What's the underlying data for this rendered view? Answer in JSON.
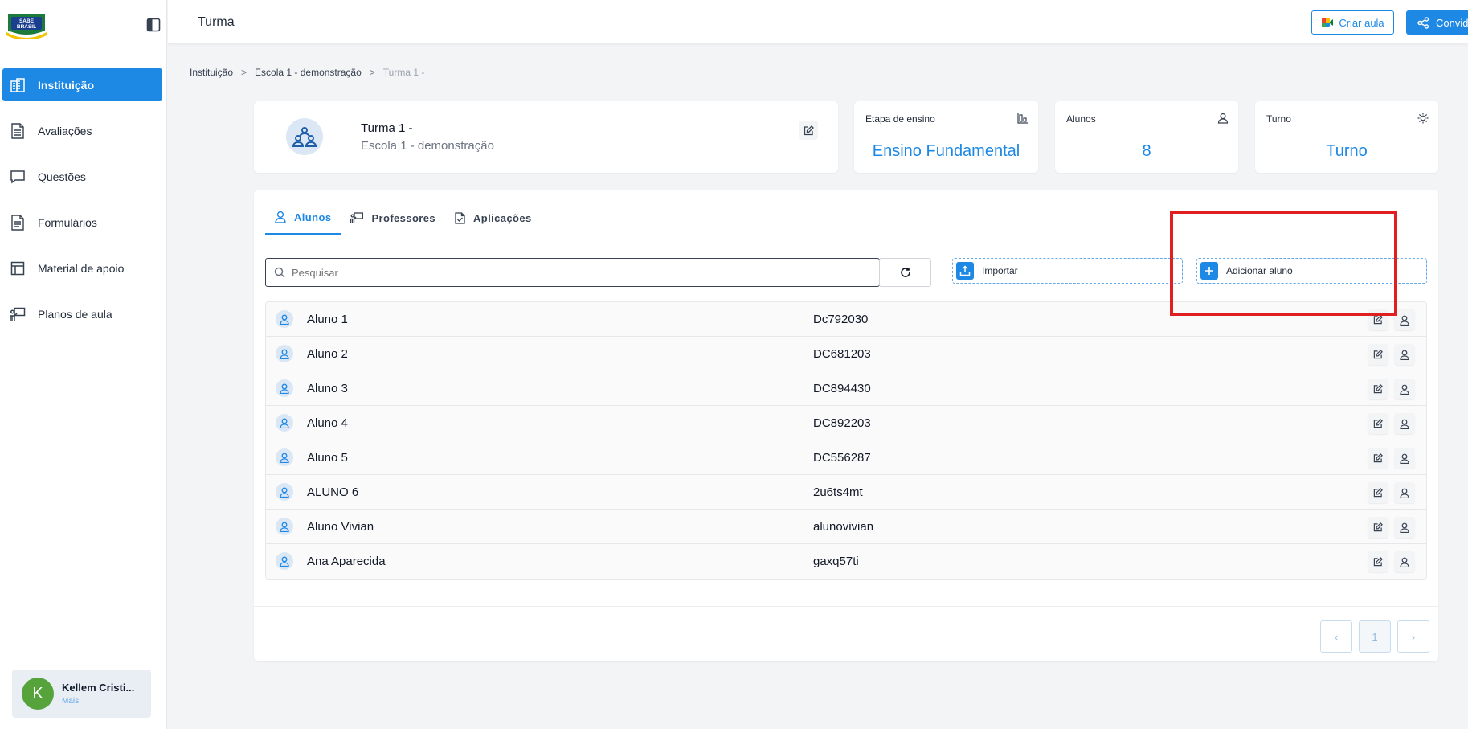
{
  "app": {
    "logo_line1": "SABE",
    "logo_line2": "BRASIL"
  },
  "sidebar": {
    "items": [
      {
        "label": "Instituição",
        "icon": "building-icon",
        "active": true
      },
      {
        "label": "Avaliações",
        "icon": "document-icon"
      },
      {
        "label": "Questões",
        "icon": "chat-icon"
      },
      {
        "label": "Formulários",
        "icon": "form-icon"
      },
      {
        "label": "Material de apoio",
        "icon": "layout-icon"
      },
      {
        "label": "Planos de aula",
        "icon": "teacher-board-icon"
      }
    ],
    "user": {
      "initial": "K",
      "name": "Kellem Cristi...",
      "sub": "Mais"
    }
  },
  "header": {
    "title": "Turma",
    "criar_aula": "Criar aula",
    "convidar": "Convid"
  },
  "breadcrumb": {
    "items": [
      "Instituição",
      "Escola 1 - demonstração",
      "Turma 1 -"
    ]
  },
  "turma": {
    "name": "Turma 1 -",
    "school": "Escola 1 - demonstração"
  },
  "stats": {
    "etapa": {
      "label": "Etapa de ensino",
      "value": "Ensino Fundamental"
    },
    "alunos": {
      "label": "Alunos",
      "value": "8"
    },
    "turno": {
      "label": "Turno",
      "value": "Turno"
    }
  },
  "tabs": [
    {
      "label": "Alunos",
      "active": true
    },
    {
      "label": "Professores"
    },
    {
      "label": "Aplicações"
    }
  ],
  "toolbar": {
    "search_placeholder": "Pesquisar",
    "import_label": "Importar",
    "add_label": "Adicionar aluno"
  },
  "students": [
    {
      "name": "Aluno 1",
      "code": "Dc792030"
    },
    {
      "name": "Aluno 2",
      "code": "DC681203"
    },
    {
      "name": "Aluno 3",
      "code": "DC894430"
    },
    {
      "name": "Aluno 4",
      "code": "DC892203"
    },
    {
      "name": "Aluno 5",
      "code": "DC556287"
    },
    {
      "name": "ALUNO 6",
      "code": "2u6ts4mt"
    },
    {
      "name": "Aluno Vivian",
      "code": "alunovivian"
    },
    {
      "name": "Ana Aparecida",
      "code": "gaxq57ti"
    }
  ],
  "pagination": {
    "prev": "‹",
    "current": "1",
    "next": "›"
  },
  "colors": {
    "primary": "#1e88e5",
    "highlight": "#e02020",
    "avatar": "#56a33c"
  }
}
